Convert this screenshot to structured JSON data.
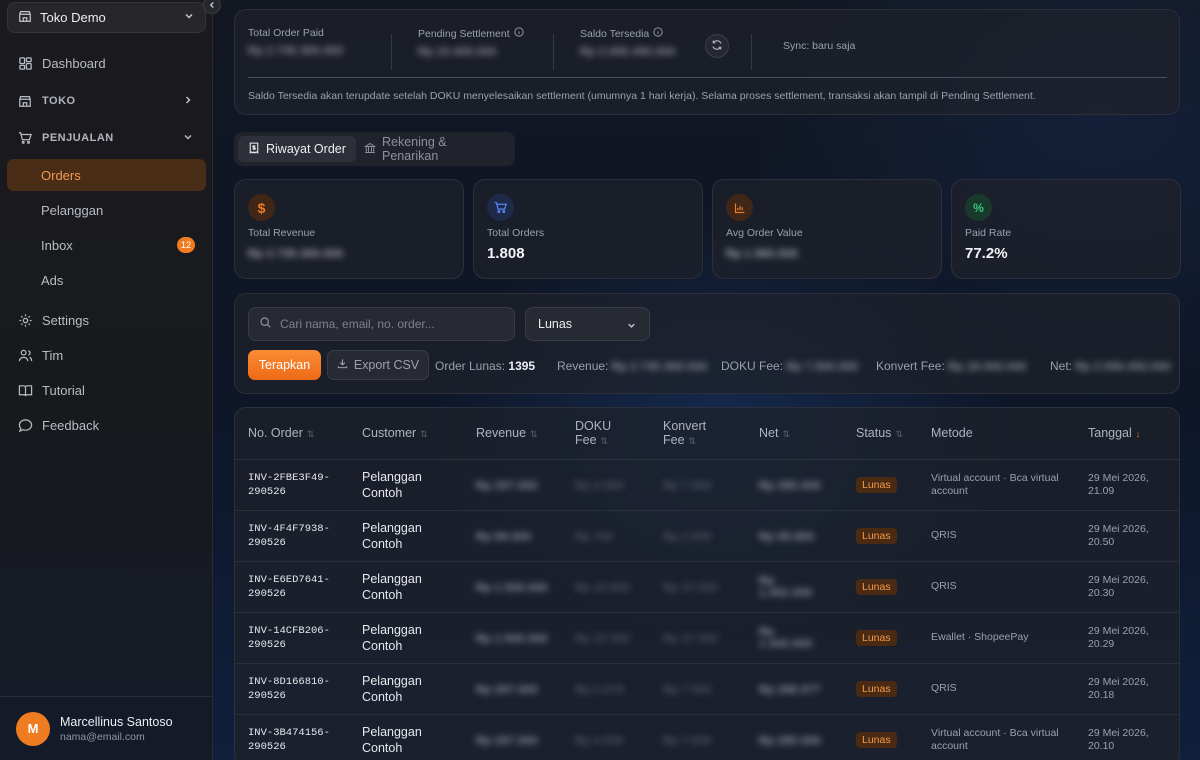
{
  "sidebar": {
    "store": "Toko Demo",
    "items": {
      "dashboard": "Dashboard",
      "toko": "TOKO",
      "penjualan": "PENJUALAN",
      "orders": "Orders",
      "pelanggan": "Pelanggan",
      "inbox": "Inbox",
      "inbox_badge": "12",
      "ads": "Ads",
      "settings": "Settings",
      "tim": "Tim",
      "tutorial": "Tutorial",
      "feedback": "Feedback"
    },
    "user": {
      "initial": "M",
      "name": "Marcellinus Santoso",
      "email": "nama@email.com"
    }
  },
  "summary": {
    "total_order_paid_label": "Total Order Paid",
    "total_order_paid_value": "Rp 2.735.300.000",
    "pending_label": "Pending Settlement",
    "pending_value": "Rp 15.400.000",
    "saldo_label": "Saldo Tersedia",
    "saldo_value": "Rp 2.056.450.000",
    "sync": "Sync: baru saja",
    "note": "Saldo Tersedia akan terupdate setelah DOKU menyelesaikan settlement (umumnya 1 hari kerja). Selama proses settlement, transaksi akan tampil di Pending Settlement."
  },
  "tabs": {
    "active": "Riwayat Order",
    "inactive": "Rekening & Penarikan"
  },
  "stats": [
    {
      "label": "Total Revenue",
      "value": "Rp 2.735.300.000",
      "blurred": true
    },
    {
      "label": "Total Orders",
      "value": "1.808",
      "blurred": false
    },
    {
      "label": "Avg Order Value",
      "value": "Rp 1.960.000",
      "blurred": true
    },
    {
      "label": "Paid Rate",
      "value": "77.2%",
      "blurred": false
    }
  ],
  "filters": {
    "search_placeholder": "Cari nama, email, no. order...",
    "status_selected": "Lunas",
    "apply": "Terapkan",
    "export": "Export CSV",
    "order_lunas_label": "Order Lunas:",
    "order_lunas_value": "1395",
    "revenue_label": "Revenue:",
    "revenue_value": "Rp 2.735.300.000",
    "doku_label": "DOKU Fee:",
    "doku_value": "Rp 7.500.000",
    "konvert_label": "Konvert Fee:",
    "konvert_value": "Rp 18.000.000",
    "net_label": "Net:",
    "net_value": "Rp 2.056.450.000"
  },
  "table": {
    "headers": [
      "No. Order",
      "Customer",
      "Revenue",
      "DOKU Fee",
      "Konvert Fee",
      "Net",
      "Status",
      "Metode",
      "Tanggal"
    ],
    "rows": [
      {
        "order": "INV-2FBE3F49-290526",
        "customer": "Pelanggan Contoh",
        "revenue": "Rp 297.000",
        "doku": "Rp 4.500",
        "konvert": "Rp 7.500",
        "net": "Rp 285.000",
        "status": "Lunas",
        "method": "Virtual account · Bca virtual account",
        "date": "29 Mei 2026, 21.09"
      },
      {
        "order": "INV-4F4F7938-290526",
        "customer": "Pelanggan Contoh",
        "revenue": "Rp 99.000",
        "doku": "Rp 700",
        "konvert": "Rp 2.500",
        "net": "Rp 95.800",
        "status": "Lunas",
        "method": "QRIS",
        "date": "29 Mei 2026, 20.50"
      },
      {
        "order": "INV-E6ED7641-290526",
        "customer": "Pelanggan Contoh",
        "revenue": "Rp 1.500.000",
        "doku": "Rp 10.500",
        "konvert": "Rp 37.500",
        "net": "Rp 1.452.000",
        "status": "Lunas",
        "method": "QRIS",
        "date": "29 Mei 2026, 20.30"
      },
      {
        "order": "INV-14CFB206-290526",
        "customer": "Pelanggan Contoh",
        "revenue": "Rp 1.500.000",
        "doku": "Rp 22.500",
        "konvert": "Rp 37.500",
        "net": "Rp 1.440.000",
        "status": "Lunas",
        "method": "Ewallet · ShopeePay",
        "date": "29 Mei 2026, 20.29"
      },
      {
        "order": "INV-8D166810-290526",
        "customer": "Pelanggan Contoh",
        "revenue": "Rp 297.000",
        "doku": "Rp 2.079",
        "konvert": "Rp 7.500",
        "net": "Rp 286.977",
        "status": "Lunas",
        "method": "QRIS",
        "date": "29 Mei 2026, 20.18"
      },
      {
        "order": "INV-3B474156-290526",
        "customer": "Pelanggan Contoh",
        "revenue": "Rp 297.000",
        "doku": "Rp 4.500",
        "konvert": "Rp 7.500",
        "net": "Rp 285.000",
        "status": "Lunas",
        "method": "Virtual account · Bca virtual account",
        "date": "29 Mei 2026, 20.10"
      }
    ]
  },
  "colors": {
    "accent": "#f07c22",
    "active_bg": "#4a2d17",
    "revenue_icon": "#f07c22",
    "orders_icon": "#4f7cf2",
    "aov_icon": "#f07c22",
    "paid_icon": "#34c77b"
  }
}
